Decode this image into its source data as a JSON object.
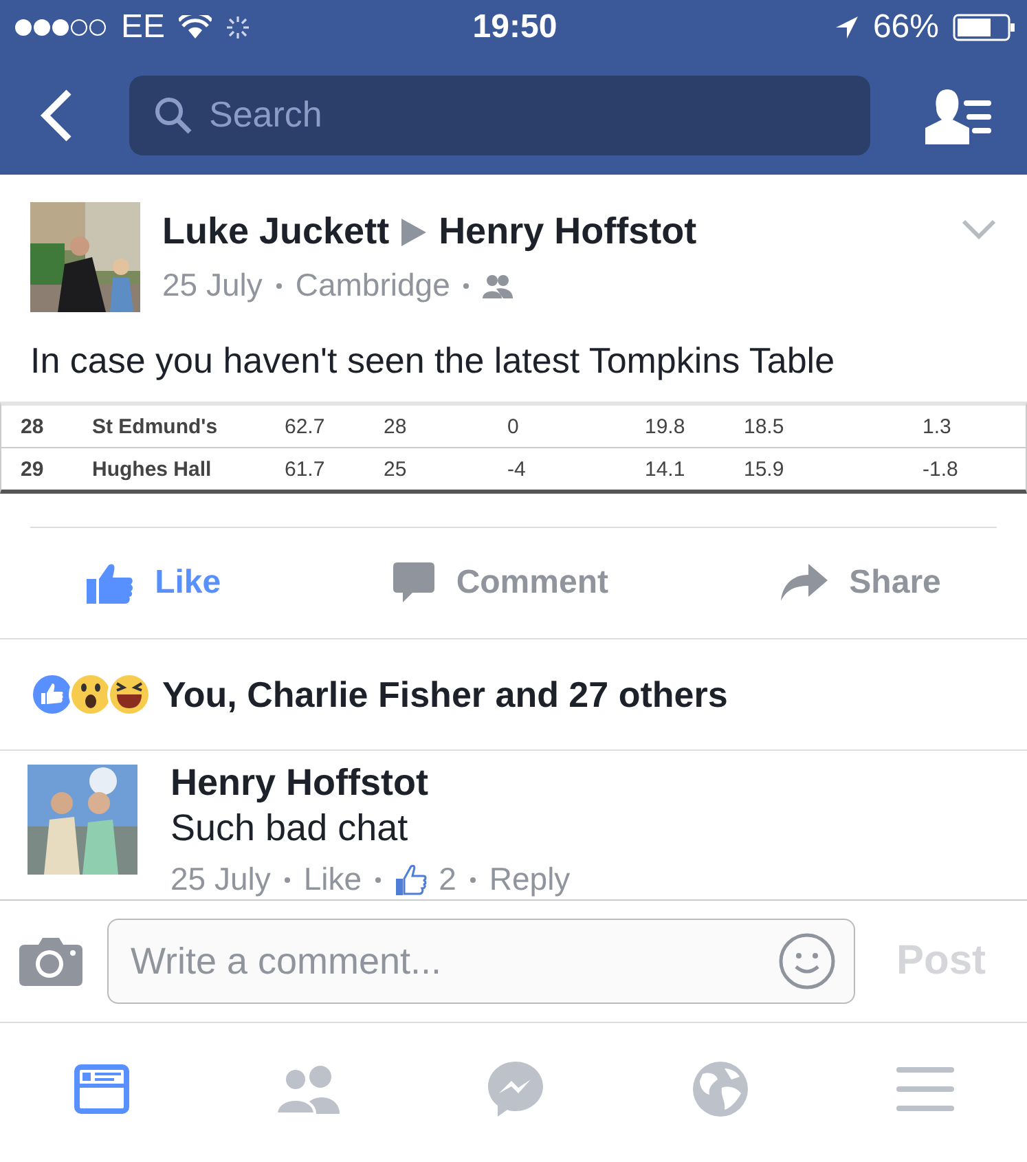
{
  "status_bar": {
    "carrier": "EE",
    "time": "19:50",
    "battery": "66%"
  },
  "nav": {
    "search": {
      "placeholder": "Search"
    }
  },
  "post": {
    "author": "Luke Juckett",
    "target": "Henry Hoffstot",
    "date": "25 July",
    "location": "Cambridge",
    "text": "In case you haven't seen the latest Tompkins Table",
    "table": {
      "rows": [
        [
          "28",
          "St Edmund's",
          "62.7",
          "28",
          "0",
          "19.8",
          "18.5",
          "1.3"
        ],
        [
          "29",
          "Hughes Hall",
          "61.7",
          "25",
          "-4",
          "14.1",
          "15.9",
          "-1.8"
        ]
      ]
    },
    "actions": [
      {
        "label": "Like",
        "kind": "like",
        "active": true
      },
      {
        "label": "Comment",
        "kind": "comment",
        "active": false
      },
      {
        "label": "Share",
        "kind": "share",
        "active": false
      }
    ],
    "reactions": {
      "kinds": [
        {
          "kind": "like"
        },
        {
          "kind": "wow"
        },
        {
          "kind": "haha"
        }
      ],
      "summary": "You, Charlie Fisher and 27 others"
    }
  },
  "comments": [
    {
      "author": "Henry Hoffstot",
      "text": "Such bad chat",
      "date": "25 July",
      "like": "Like",
      "likes": "2",
      "reply": "Reply"
    }
  ],
  "composer": {
    "placeholder": "Write a comment...",
    "post": "Post"
  },
  "tab_bar": [
    {
      "kind": "feed",
      "selected": true
    },
    {
      "kind": "friends",
      "selected": false
    },
    {
      "kind": "messenger",
      "selected": false
    },
    {
      "kind": "globe",
      "selected": false
    },
    {
      "kind": "menu",
      "selected": false
    }
  ]
}
